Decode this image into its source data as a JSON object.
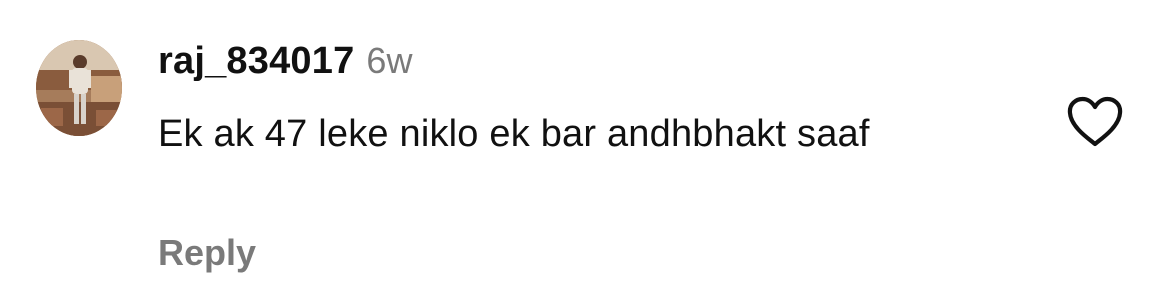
{
  "comment": {
    "username": "raj_834017",
    "timestamp": "6w",
    "text": "Ek ak 47 leke niklo ek bar andhbhakt saaf",
    "reply_label": "Reply"
  },
  "icons": {
    "like": "heart-outline-icon",
    "avatar": "user-avatar"
  }
}
